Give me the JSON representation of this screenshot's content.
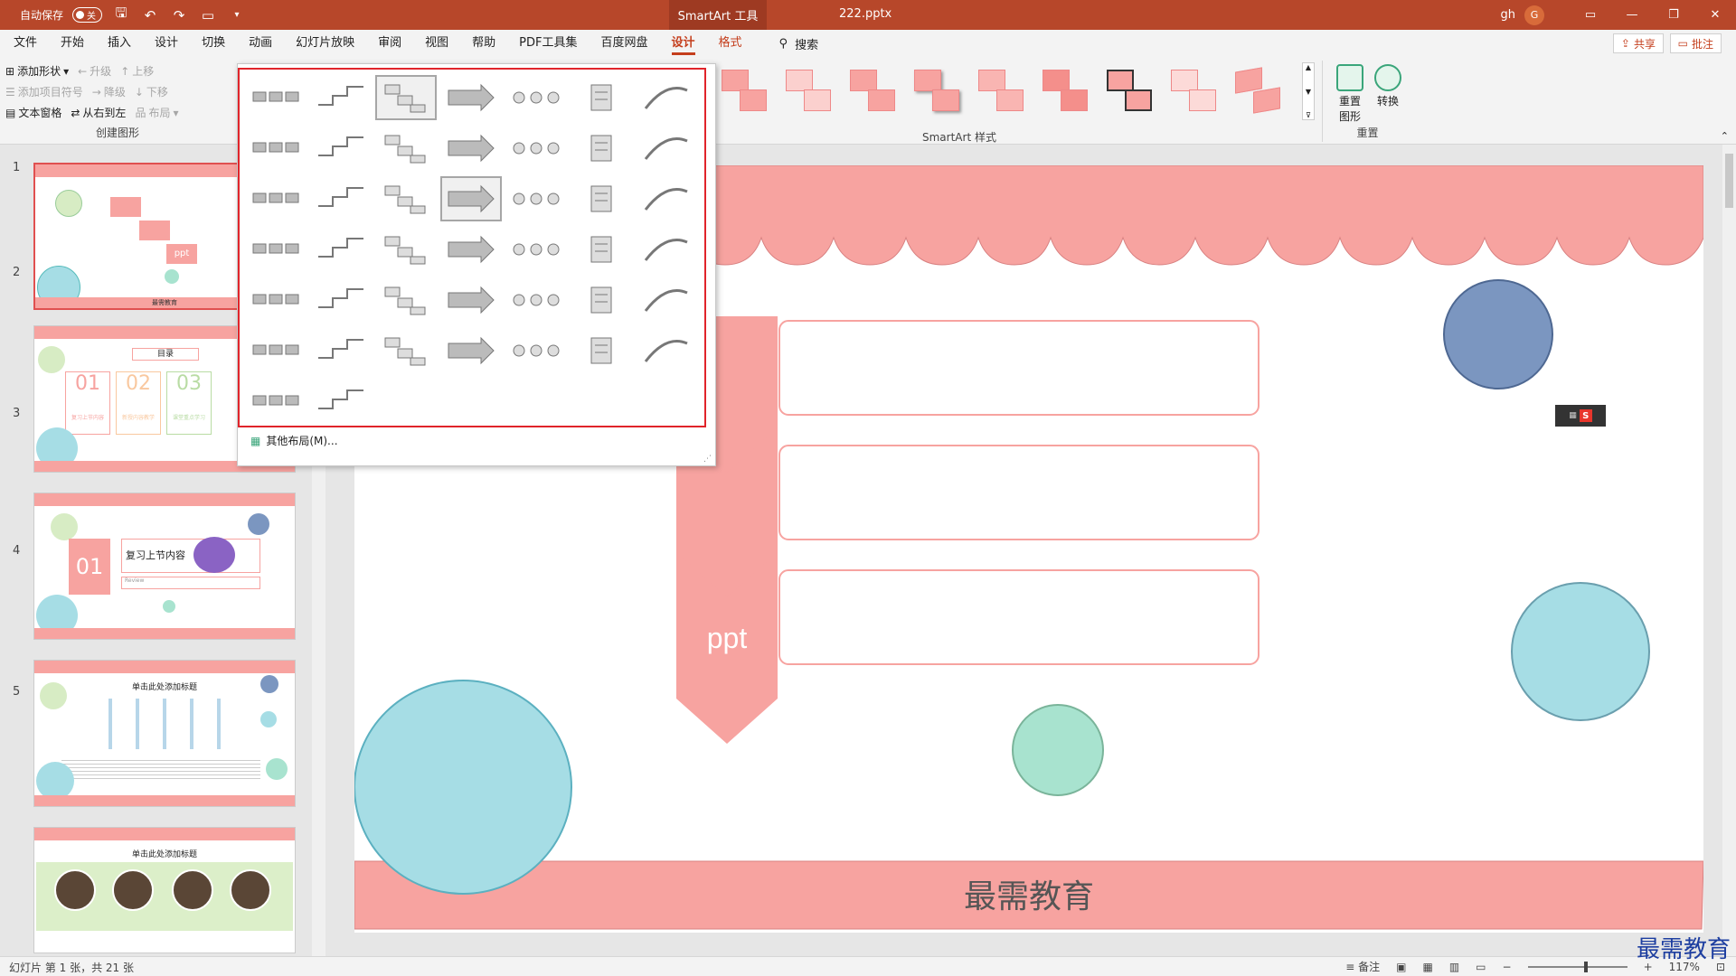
{
  "titlebar": {
    "autosave_label": "自动保存",
    "autosave_state": "关",
    "context_tab": "SmartArt 工具",
    "doc_title": "222.pptx",
    "user_name": "gh",
    "user_initial": "G"
  },
  "tabs": [
    {
      "label": "文件"
    },
    {
      "label": "开始"
    },
    {
      "label": "插入"
    },
    {
      "label": "设计"
    },
    {
      "label": "切换"
    },
    {
      "label": "动画"
    },
    {
      "label": "幻灯片放映"
    },
    {
      "label": "审阅"
    },
    {
      "label": "视图"
    },
    {
      "label": "帮助"
    },
    {
      "label": "PDF工具集"
    },
    {
      "label": "百度网盘"
    },
    {
      "label": "设计"
    },
    {
      "label": "格式"
    }
  ],
  "search_label": "搜索",
  "share_label": "共享",
  "comment_label": "批注",
  "create_group": {
    "add_shape": "添加形状",
    "promote": "升级",
    "move_up": "上移",
    "add_bullet": "添加项目符号",
    "demote": "降级",
    "move_down": "下移",
    "text_pane": "文本窗格",
    "rtl": "从右到左",
    "layout": "布局",
    "label": "创建图形"
  },
  "styles_label": "SmartArt 样式",
  "reset_group": {
    "reset_graphic": "重置\n图形",
    "convert": "转换",
    "label": "重置"
  },
  "gallery": {
    "more_layouts": "其他布局(M)..."
  },
  "slides": [
    {
      "num": "1",
      "ppt": "ppt",
      "footer": "最需教育"
    },
    {
      "num": "2",
      "title": "目录",
      "items": [
        "01",
        "02",
        "03"
      ],
      "captions": [
        "复习上节内容",
        "新授内容教学",
        "课堂重点学习"
      ]
    },
    {
      "num": "3",
      "big_num": "01",
      "heading": "复习上节内容",
      "sub": "Review"
    },
    {
      "num": "4",
      "title": "单击此处添加标题"
    },
    {
      "num": "5",
      "title": "单击此处添加标题"
    }
  ],
  "slide_main": {
    "ppt_label": "ppt",
    "footer_text": "最需教育"
  },
  "status": {
    "slide_info": "幻灯片 第 1 张，共 21 张",
    "notes": "备注",
    "zoom": "117%"
  },
  "watermark": "最需教育",
  "colors": {
    "accent": "#c43e1c",
    "pink": "#f7a3a0",
    "teal": "#a6dde5",
    "navy": "#7b96c0",
    "mint": "#a8e3cf",
    "titlebar": "#b7472a"
  }
}
